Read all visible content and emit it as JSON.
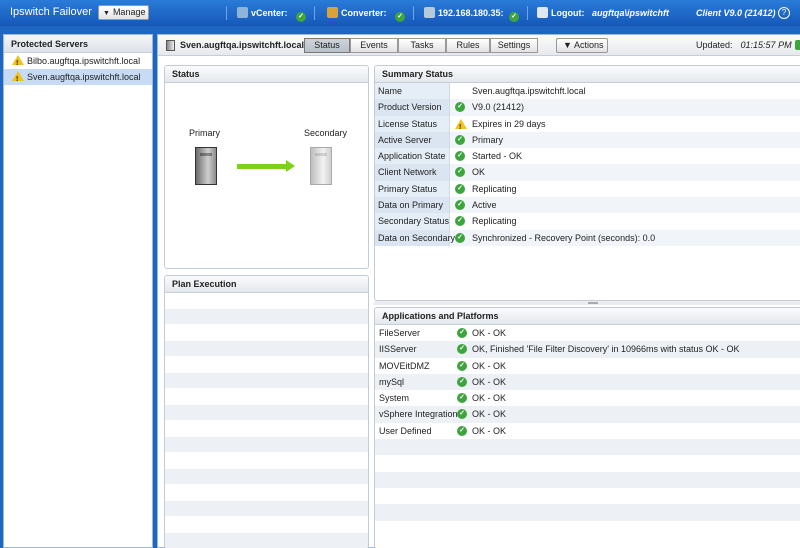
{
  "topbar": {
    "app_title": "Ipswitch Failover",
    "manage_label": "Manage",
    "vcenter_label": "vCenter:",
    "converter_label": "Converter:",
    "ip_label": "192.168.180.35:",
    "logout_label": "Logout:",
    "user": "augftqa\\ipswitchft",
    "client_version": "Client V9.0 (21412)",
    "help": "?"
  },
  "sidebar": {
    "title": "Protected Servers",
    "items": [
      {
        "label": "Bilbo.augftqa.ipswitchft.local",
        "status": "warning"
      },
      {
        "label": "Sven.augftqa.ipswitchft.local",
        "status": "warning"
      }
    ]
  },
  "main": {
    "server_title": "Sven.augftqa.ipswitchft.local",
    "tabs": [
      "Status",
      "Events",
      "Tasks",
      "Rules",
      "Settings"
    ],
    "actions_label": "Actions",
    "updated_label": "Updated:",
    "updated_time": "01:15:57 PM"
  },
  "status_box": {
    "title": "Status",
    "primary_label": "Primary",
    "secondary_label": "Secondary"
  },
  "plan_box": {
    "title": "Plan Execution"
  },
  "summary": {
    "title": "Summary Status",
    "rows": [
      {
        "label": "Name",
        "icon": "",
        "value": "Sven.augftqa.ipswitchft.local"
      },
      {
        "label": "Product Version",
        "icon": "ok",
        "value": "V9.0 (21412)"
      },
      {
        "label": "License Status",
        "icon": "warning",
        "value": "Expires in 29 days"
      },
      {
        "label": "Active Server",
        "icon": "ok",
        "value": "Primary"
      },
      {
        "label": "Application State",
        "icon": "ok",
        "value": "Started - OK"
      },
      {
        "label": "Client Network",
        "icon": "ok",
        "value": "OK"
      },
      {
        "label": "Primary Status",
        "icon": "ok",
        "value": "Replicating"
      },
      {
        "label": "Data on Primary",
        "icon": "ok",
        "value": "Active"
      },
      {
        "label": "Secondary Status",
        "icon": "ok",
        "value": "Replicating"
      },
      {
        "label": "Data on Secondary",
        "icon": "ok",
        "value": "Synchronized - Recovery Point (seconds): 0.0"
      }
    ]
  },
  "apps": {
    "title": "Applications and Platforms",
    "rows": [
      {
        "label": "FileServer",
        "value": "OK - OK"
      },
      {
        "label": "IISServer",
        "value": "OK, Finished 'File Filter Discovery' in 10966ms with status OK - OK"
      },
      {
        "label": "MOVEitDMZ",
        "value": "OK - OK"
      },
      {
        "label": "mySql",
        "value": "OK - OK"
      },
      {
        "label": "System",
        "value": "OK - OK"
      },
      {
        "label": "vSphere Integration",
        "value": "OK - OK"
      },
      {
        "label": "User Defined",
        "value": "OK - OK"
      }
    ]
  },
  "colors": {
    "topbar": "#1d67c2",
    "ok": "#3ea53e",
    "warning": "#f2c21b",
    "arrow": "#7ad318",
    "selected_row": "#c7dbf5"
  }
}
